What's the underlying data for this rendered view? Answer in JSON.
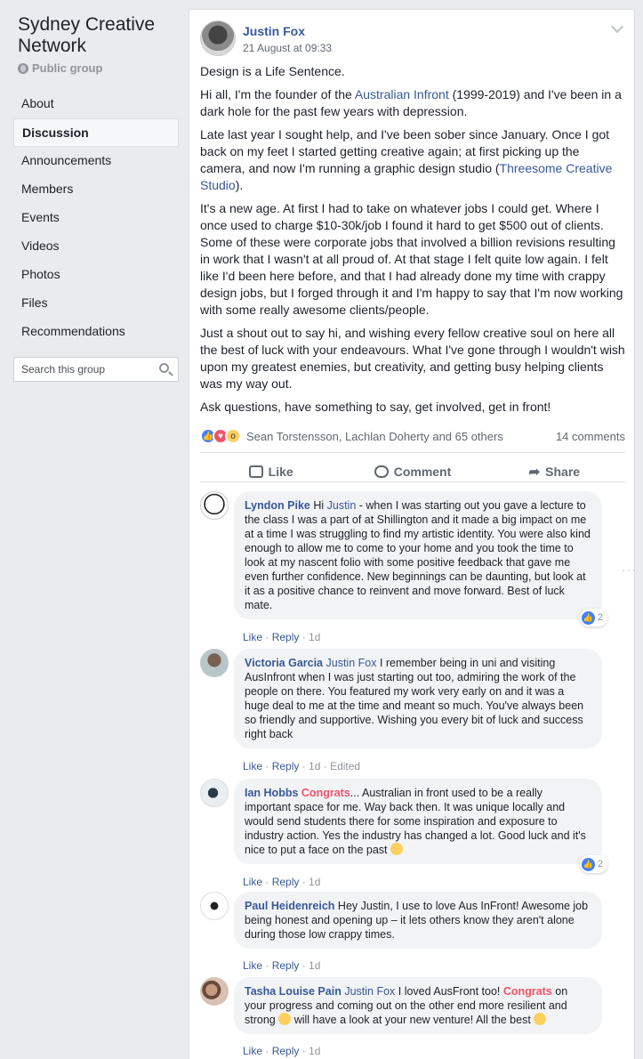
{
  "group": {
    "name": "Sydney Creative Network",
    "type": "Public group"
  },
  "nav": [
    {
      "label": "About",
      "active": false
    },
    {
      "label": "Discussion",
      "active": true
    },
    {
      "label": "Announcements",
      "active": false
    },
    {
      "label": "Members",
      "active": false
    },
    {
      "label": "Events",
      "active": false
    },
    {
      "label": "Videos",
      "active": false
    },
    {
      "label": "Photos",
      "active": false
    },
    {
      "label": "Files",
      "active": false
    },
    {
      "label": "Recommendations",
      "active": false
    }
  ],
  "search": {
    "placeholder": "Search this group"
  },
  "post": {
    "author": "Justin Fox",
    "date": "21 August at 09:33",
    "p1": "Design is a Life Sentence.",
    "p2a": "Hi all, I'm the founder of the ",
    "p2link": "Australian Infront",
    "p2b": " (1999-2019) and I've been in a dark hole for the past few years with depression.",
    "p3a": "Late last year I sought help, and I've been sober since January. Once I got back on my feet I started getting creative again; at first picking up the camera, and now I'm running a graphic design studio (",
    "p3link": "Threesome Creative Studio",
    "p3b": ").",
    "p4": "It's a new age. At first I had to take on whatever jobs I could get. Where I once used to charge $10-30k/job I found it hard to get $500 out of clients. Some of these were corporate jobs that involved a billion revisions resulting in work that I wasn't at all proud of. At that stage I felt quite low again. I felt like I'd been here before, and that I had already done my time with crappy design jobs, but I forged through it and I'm happy to say that I'm now working with some really awesome clients/people.",
    "p5": "Just a shout out to say hi, and wishing every fellow creative soul on here all the best of luck with your endeavours. What I've gone through I wouldn't wish upon my greatest enemies, but creativity, and getting busy helping clients was my way out.",
    "p6": "Ask questions, have something to say, get involved, get in front!",
    "reaction_names": "Sean Torstensson, Lachlan Doherty and 65 others",
    "comment_count": "14 comments",
    "actions": {
      "like": "Like",
      "comment": "Comment",
      "share": "Share"
    }
  },
  "comments": [
    {
      "name": "Lyndon Pike",
      "mention": "Justin",
      "pre": "Hi ",
      "text": " - when I was starting out you gave a lecture to the class I was a part of at Shillington and it made a big impact on me at a time I was struggling to find my artistic identity. You were also kind enough to allow me to come to your home and you took the time to look at my nascent folio with some positive feedback that gave me even further confidence. New beginnings can be daunting, but look at it as a positive chance to reinvent and move forward. Best of luck mate.",
      "like": "Like",
      "reply": "Reply",
      "time": "1d",
      "edited": "",
      "reactions": "2"
    },
    {
      "name": "Victoria Garcia",
      "mention": "Justin Fox",
      "pre": "",
      "text": " I remember being in uni and visiting AusInfront when I was just starting out too, admiring the work of the people on there. You featured my work very early on and it was a huge deal to me at the time and meant so much. You've always been so friendly and supportive. Wishing you every bit of luck and success right back",
      "like": "Like",
      "reply": "Reply",
      "time": "1d",
      "edited": "Edited",
      "reactions": ""
    },
    {
      "name": "Ian Hobbs",
      "congrats": "Congrats",
      "text": "... Australian in front used to be a really important space for me. Way back then. It was unique locally and would send students there for some inspiration and exposure to industry action. Yes the industry has changed a lot. Good luck and it's nice to put a face on the past",
      "like": "Like",
      "reply": "Reply",
      "time": "1d",
      "edited": "",
      "reactions": "2"
    },
    {
      "name": "Paul Heidenreich",
      "text": "Hey Justin, I use to love Aus InFront! Awesome job being honest and opening up – it lets others know they aren't alone during those low crappy times.",
      "like": "Like",
      "reply": "Reply",
      "time": "1d",
      "edited": "",
      "reactions": ""
    },
    {
      "name": "Tasha Louise Pain",
      "mention": "Justin Fox",
      "text1": " I loved AusFront too! ",
      "congrats": "Congrats",
      "text2": "  on your progress and coming out on the other end more resilient and strong ",
      "text3": " will have a look at your new venture! All the best ",
      "like": "Like",
      "reply": "Reply",
      "time": "1d",
      "edited": "",
      "reactions": ""
    }
  ],
  "colors": {
    "link": "#385898",
    "congrats": "#f25268",
    "like": "#4080ff"
  }
}
